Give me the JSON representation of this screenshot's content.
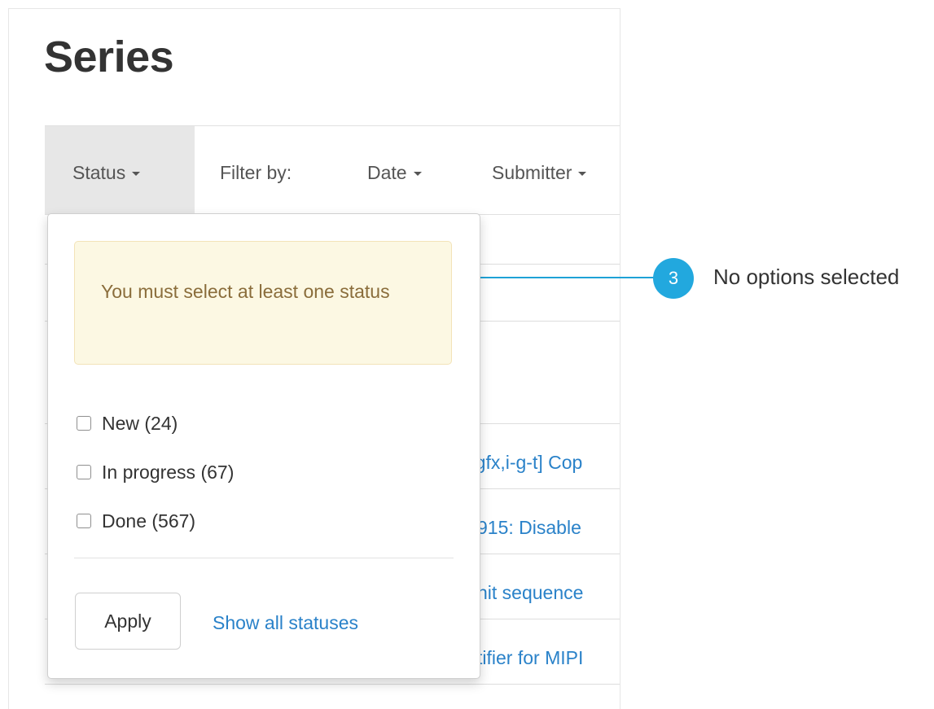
{
  "page": {
    "title": "Series"
  },
  "filter_bar": {
    "status_label": "Status",
    "filter_by_label": "Filter by:",
    "date_label": "Date",
    "submitter_label": "Submitter"
  },
  "series_list": {
    "rows": [
      {
        "title_fragment": "-gfx,i-g-t] Cop"
      },
      {
        "title_fragment": "915: Disable"
      },
      {
        "title_fragment": "nit sequence"
      },
      {
        "title_fragment": "tifier for MIPI"
      }
    ]
  },
  "status_dropdown": {
    "warning": "You must select at least one status",
    "options": [
      {
        "label": "New (24)",
        "checked": false
      },
      {
        "label": "In progress (67)",
        "checked": false
      },
      {
        "label": "Done (567)",
        "checked": false
      }
    ],
    "apply_label": "Apply",
    "show_all_label": "Show all statuses"
  },
  "callout": {
    "number": "3",
    "text": "No options selected"
  },
  "colors": {
    "accent": "#22a8de",
    "link": "#2a82c9",
    "warning_bg": "#fcf8e3",
    "warning_text": "#8a6d3b"
  }
}
